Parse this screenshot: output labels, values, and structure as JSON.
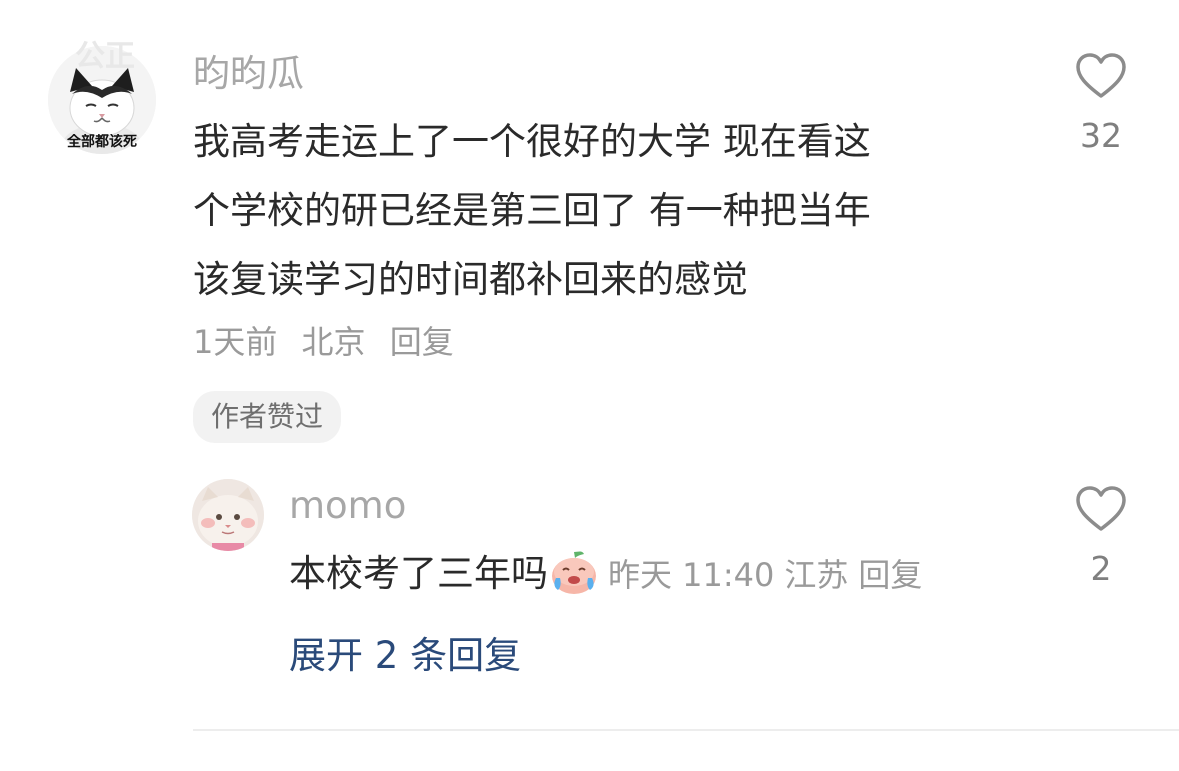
{
  "comment": {
    "username": "昀昀瓜",
    "avatar_caption": "全部都该死",
    "avatar_top_text": "公正",
    "text_lines": [
      "我高考走运上了一个很好的大学 现在看这",
      "个学校的研已经是第三回了 有一种把当年",
      "该复读学习的时间都补回来的感觉"
    ],
    "meta": {
      "time": "1天前",
      "location": "北京",
      "reply_label": "回复"
    },
    "badge": "作者赞过",
    "like_count": "32",
    "icon": "heart-outline-icon"
  },
  "reply": {
    "username": "momo",
    "text": "本校考了三年吗",
    "emoji_icon": "crying-peach-emoji-icon",
    "meta": {
      "time": "昨天 11:40",
      "location": "江苏",
      "reply_label": "回复"
    },
    "like_count": "2",
    "icon": "heart-outline-icon"
  },
  "expand_label": "展开 2 条回复",
  "colors": {
    "username": "#a7a7a7",
    "meta": "#9a9a9a",
    "link": "#2a4a7a",
    "text": "#2a2a2a"
  }
}
